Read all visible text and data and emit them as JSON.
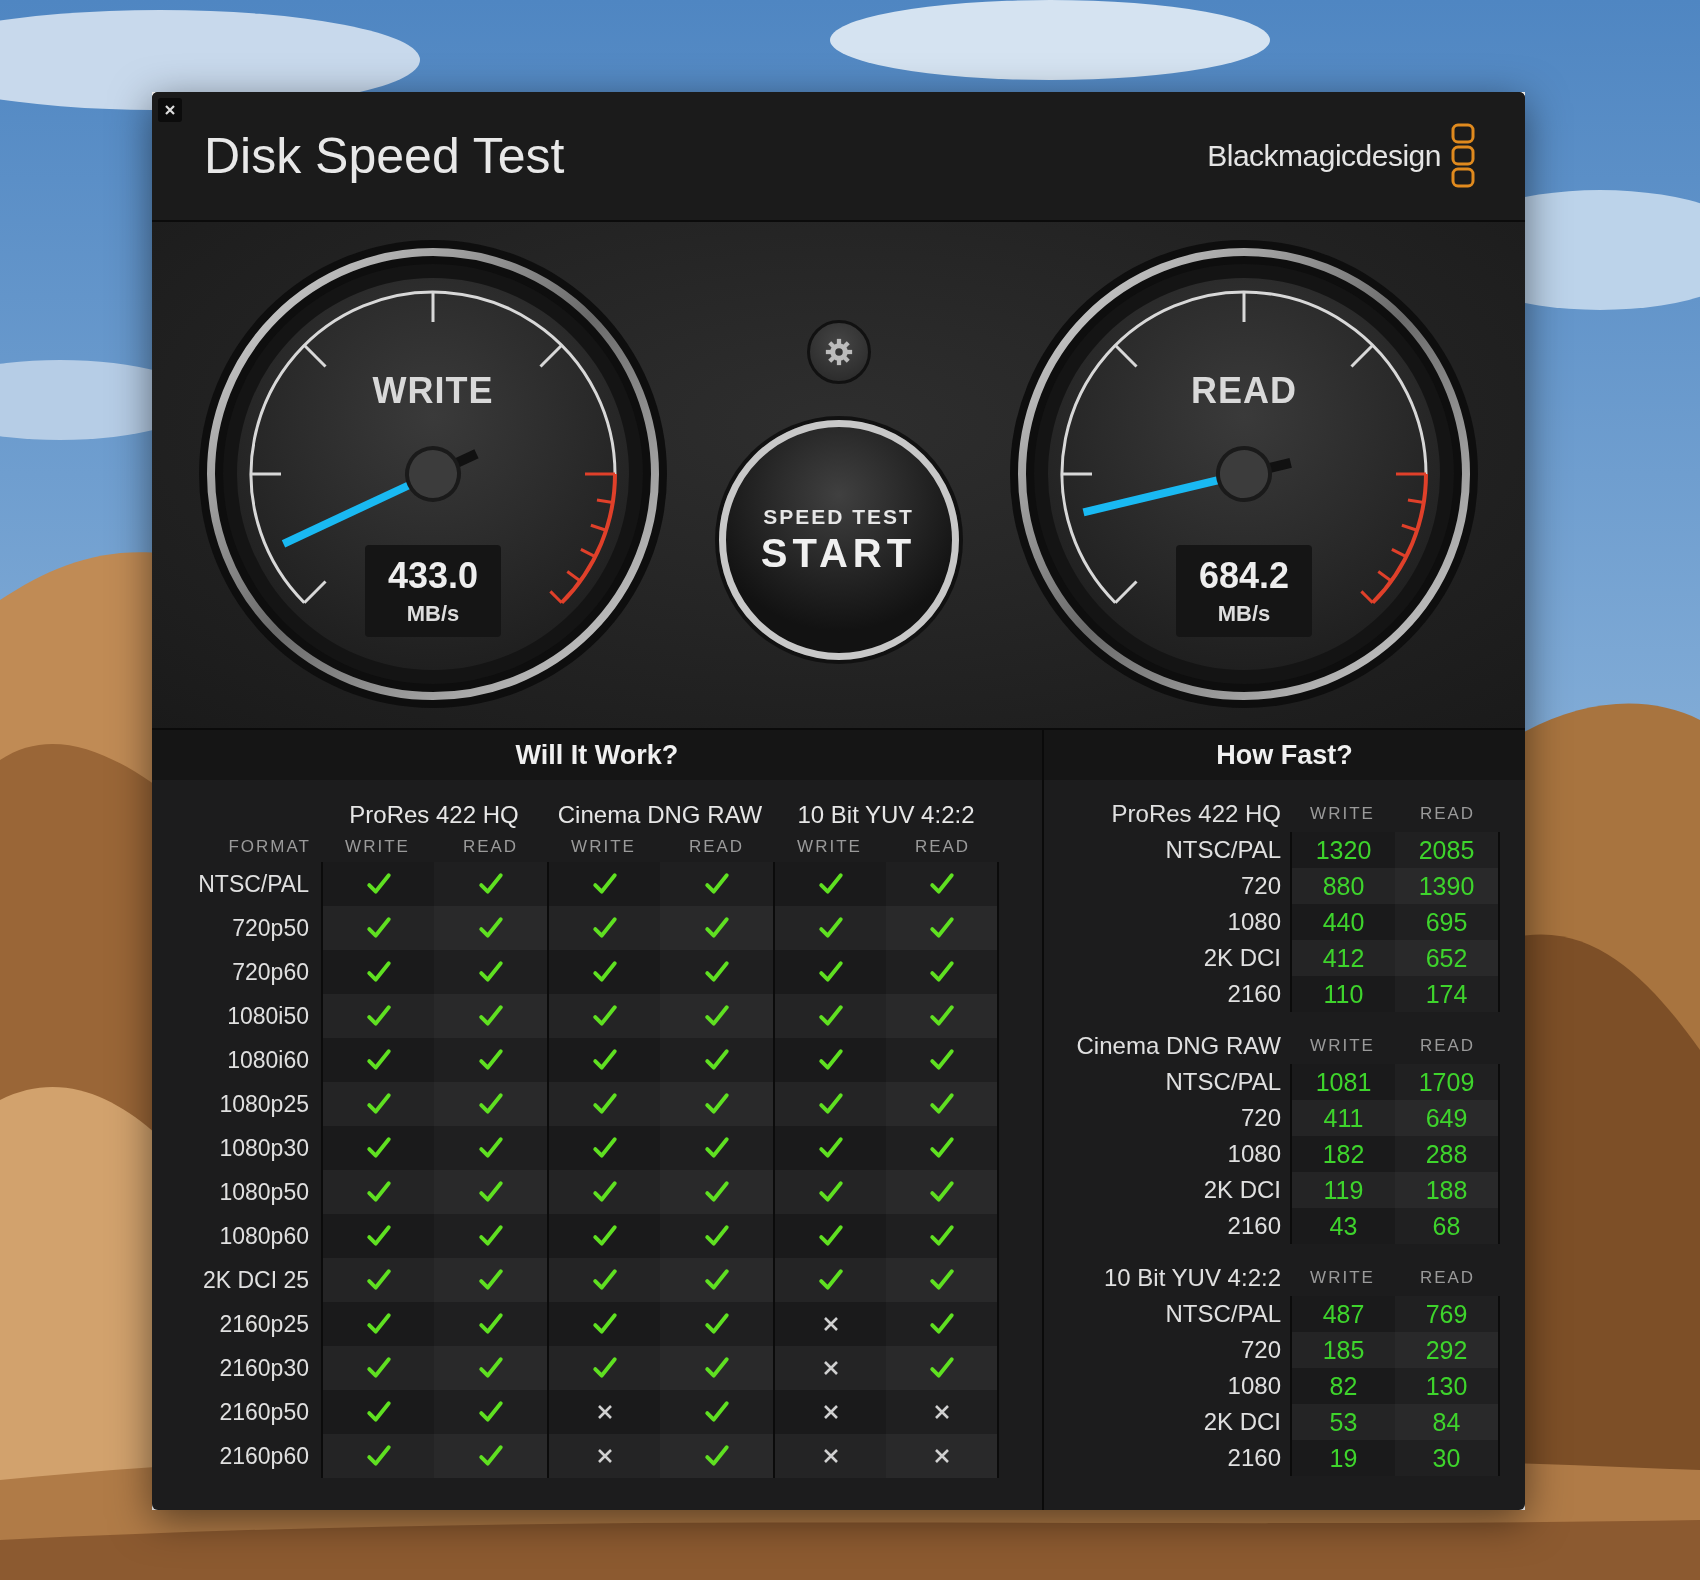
{
  "window": {
    "title": "Disk Speed Test",
    "brand": "Blackmagicdesign"
  },
  "gauges": [
    {
      "label": "WRITE",
      "value": "433.0",
      "unit": "MB/s"
    },
    {
      "label": "READ",
      "value": "684.2",
      "unit": "MB/s"
    }
  ],
  "start_button": {
    "caption": "SPEED TEST",
    "label": "START"
  },
  "will_it_work": {
    "title": "Will It Work?",
    "format_header": "FORMAT",
    "groups": [
      {
        "name": "ProRes 422 HQ",
        "columns": [
          "WRITE",
          "READ"
        ]
      },
      {
        "name": "Cinema DNG RAW",
        "columns": [
          "WRITE",
          "READ"
        ]
      },
      {
        "name": "10 Bit YUV 4:2:2",
        "columns": [
          "WRITE",
          "READ"
        ]
      }
    ],
    "rows": [
      {
        "format": "NTSC/PAL",
        "results": [
          {
            "ok": true
          },
          {
            "ok": true
          },
          {
            "ok": true
          },
          {
            "ok": true
          },
          {
            "ok": true
          },
          {
            "ok": true
          }
        ]
      },
      {
        "format": "720p50",
        "results": [
          {
            "ok": true
          },
          {
            "ok": true
          },
          {
            "ok": true
          },
          {
            "ok": true
          },
          {
            "ok": true
          },
          {
            "ok": true
          }
        ]
      },
      {
        "format": "720p60",
        "results": [
          {
            "ok": true
          },
          {
            "ok": true
          },
          {
            "ok": true
          },
          {
            "ok": true
          },
          {
            "ok": true
          },
          {
            "ok": true
          }
        ]
      },
      {
        "format": "1080i50",
        "results": [
          {
            "ok": true
          },
          {
            "ok": true
          },
          {
            "ok": true
          },
          {
            "ok": true
          },
          {
            "ok": true
          },
          {
            "ok": true
          }
        ]
      },
      {
        "format": "1080i60",
        "results": [
          {
            "ok": true
          },
          {
            "ok": true
          },
          {
            "ok": true
          },
          {
            "ok": true
          },
          {
            "ok": true
          },
          {
            "ok": true
          }
        ]
      },
      {
        "format": "1080p25",
        "results": [
          {
            "ok": true
          },
          {
            "ok": true
          },
          {
            "ok": true
          },
          {
            "ok": true
          },
          {
            "ok": true
          },
          {
            "ok": true
          }
        ]
      },
      {
        "format": "1080p30",
        "results": [
          {
            "ok": true
          },
          {
            "ok": true
          },
          {
            "ok": true
          },
          {
            "ok": true
          },
          {
            "ok": true
          },
          {
            "ok": true
          }
        ]
      },
      {
        "format": "1080p50",
        "results": [
          {
            "ok": true
          },
          {
            "ok": true
          },
          {
            "ok": true
          },
          {
            "ok": true
          },
          {
            "ok": true
          },
          {
            "ok": true
          }
        ]
      },
      {
        "format": "1080p60",
        "results": [
          {
            "ok": true
          },
          {
            "ok": true
          },
          {
            "ok": true
          },
          {
            "ok": true
          },
          {
            "ok": true
          },
          {
            "ok": true
          }
        ]
      },
      {
        "format": "2K DCI 25",
        "results": [
          {
            "ok": true
          },
          {
            "ok": true
          },
          {
            "ok": true
          },
          {
            "ok": true
          },
          {
            "ok": true
          },
          {
            "ok": true
          }
        ]
      },
      {
        "format": "2160p25",
        "results": [
          {
            "ok": true
          },
          {
            "ok": true
          },
          {
            "ok": true
          },
          {
            "ok": true
          },
          {
            "ok": false
          },
          {
            "ok": true
          }
        ]
      },
      {
        "format": "2160p30",
        "results": [
          {
            "ok": true
          },
          {
            "ok": true
          },
          {
            "ok": true
          },
          {
            "ok": true
          },
          {
            "ok": false
          },
          {
            "ok": true
          }
        ]
      },
      {
        "format": "2160p50",
        "results": [
          {
            "ok": true
          },
          {
            "ok": true
          },
          {
            "ok": false
          },
          {
            "ok": true
          },
          {
            "ok": false
          },
          {
            "ok": false
          }
        ]
      },
      {
        "format": "2160p60",
        "results": [
          {
            "ok": true
          },
          {
            "ok": true
          },
          {
            "ok": false
          },
          {
            "ok": true
          },
          {
            "ok": false
          },
          {
            "ok": false
          }
        ]
      }
    ]
  },
  "how_fast": {
    "title": "How Fast?",
    "groups": [
      {
        "name": "ProRes 422 HQ",
        "columns": [
          "WRITE",
          "READ"
        ],
        "rows": [
          {
            "format": "NTSC/PAL",
            "write": "1320",
            "read": "2085"
          },
          {
            "format": "720",
            "write": "880",
            "read": "1390"
          },
          {
            "format": "1080",
            "write": "440",
            "read": "695"
          },
          {
            "format": "2K DCI",
            "write": "412",
            "read": "652"
          },
          {
            "format": "2160",
            "write": "110",
            "read": "174"
          }
        ]
      },
      {
        "name": "Cinema DNG RAW",
        "columns": [
          "WRITE",
          "READ"
        ],
        "rows": [
          {
            "format": "NTSC/PAL",
            "write": "1081",
            "read": "1709"
          },
          {
            "format": "720",
            "write": "411",
            "read": "649"
          },
          {
            "format": "1080",
            "write": "182",
            "read": "288"
          },
          {
            "format": "2K DCI",
            "write": "119",
            "read": "188"
          },
          {
            "format": "2160",
            "write": "43",
            "read": "68"
          }
        ]
      },
      {
        "name": "10 Bit YUV 4:2:2",
        "columns": [
          "WRITE",
          "READ"
        ],
        "rows": [
          {
            "format": "NTSC/PAL",
            "write": "487",
            "read": "769"
          },
          {
            "format": "720",
            "write": "185",
            "read": "292"
          },
          {
            "format": "1080",
            "write": "82",
            "read": "130"
          },
          {
            "format": "2K DCI",
            "write": "53",
            "read": "84"
          },
          {
            "format": "2160",
            "write": "19",
            "read": "30"
          }
        ]
      }
    ]
  }
}
